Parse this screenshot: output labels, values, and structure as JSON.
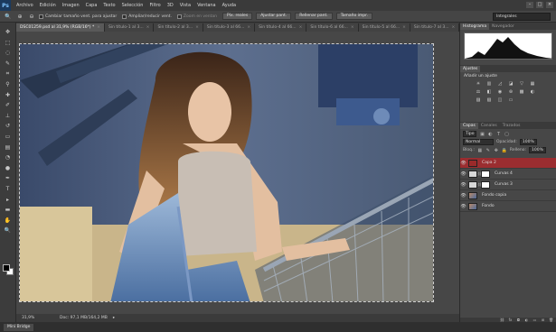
{
  "app": {
    "logo": "Ps"
  },
  "menu": [
    "Archivo",
    "Edición",
    "Imagen",
    "Capa",
    "Texto",
    "Selección",
    "Filtro",
    "3D",
    "Vista",
    "Ventana",
    "Ayuda"
  ],
  "window_controls": [
    "–",
    "□",
    "×"
  ],
  "options": {
    "checks": [
      {
        "label": "Cambiar tamaño vent. para ajustar",
        "checked": false,
        "dim": false
      },
      {
        "label": "Ampliar/reducir vent.",
        "checked": false,
        "dim": false
      },
      {
        "label": "Zoom en ventan",
        "checked": false,
        "dim": true
      }
    ],
    "buttons": [
      "Píx. reales",
      "Ajustar pant.",
      "Rellenar pant.",
      "Tamaño impr."
    ],
    "workspace": "Integrales"
  },
  "tabs": [
    {
      "label": "DSC01259.psd al 31,9% (RGB/16*) *",
      "active": true
    },
    {
      "label": "Sin título-1 al 3...",
      "active": false
    },
    {
      "label": "Sin título-2 al 3...",
      "active": false
    },
    {
      "label": "Sin título-3 al 66...",
      "active": false
    },
    {
      "label": "Sin título-4 al 66...",
      "active": false
    },
    {
      "label": "Sin título-6 al 66...",
      "active": false
    },
    {
      "label": "Sin título-5 al 66...",
      "active": false
    },
    {
      "label": "Sin título-7 al 3...",
      "active": false
    }
  ],
  "status": {
    "zoom": "31,9%",
    "doc": "Doc: 97,1 MB/164,2 MB",
    "arrow": "▸"
  },
  "bottom": {
    "mini_bridge": "Mini Bridge"
  },
  "panels": {
    "top_tabs": [
      "Histograma",
      "Navegador"
    ],
    "adjustments": {
      "tab": "Ajustes",
      "title": "Añadir un ajuste"
    },
    "layer_tabs": [
      "Capas",
      "Canales",
      "Trazados"
    ],
    "filter_select": "Tipo",
    "blend_mode": "Normal",
    "opacity_label": "Opacidad:",
    "opacity_value": "100%",
    "lock_label": "Bloq.:",
    "fill_label": "Relleno:",
    "fill_value": "100%",
    "layers": [
      {
        "name": "Capa 2",
        "active": true,
        "thumb": "red",
        "mask": false
      },
      {
        "name": "Curvas 4",
        "active": false,
        "thumb": "curve",
        "mask": true
      },
      {
        "name": "Curvas 3",
        "active": false,
        "thumb": "curve",
        "mask": true
      },
      {
        "name": "Fondo copia",
        "active": false,
        "thumb": "photo",
        "mask": false
      },
      {
        "name": "Fondo",
        "active": false,
        "thumb": "photo",
        "mask": false
      }
    ]
  },
  "colors": {
    "active_layer": "#9b2d30",
    "accent_logo": "#1b3a5e"
  }
}
